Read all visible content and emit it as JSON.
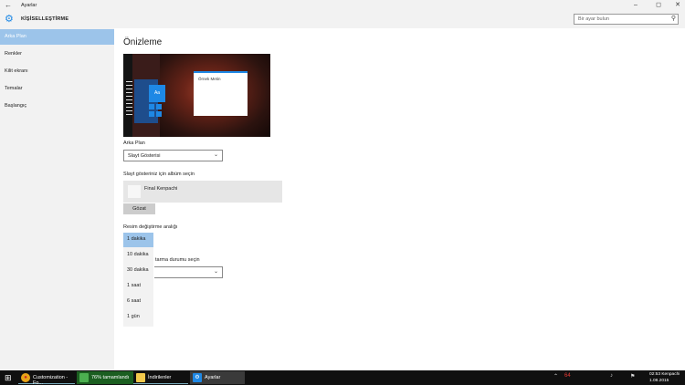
{
  "titlebar": {
    "back": "←",
    "title": "Ayarlar",
    "minimize": "–",
    "maximize": "◻",
    "close": "✕"
  },
  "header": {
    "gear": "⚙",
    "title": "KİŞİSELLEŞTİRME"
  },
  "search": {
    "placeholder": "Bir ayar bulun",
    "icon": "⚲"
  },
  "sidebar": {
    "items": [
      {
        "label": "Arka Plan"
      },
      {
        "label": "Renkler"
      },
      {
        "label": "Kilit ekranı"
      },
      {
        "label": "Temalar"
      },
      {
        "label": "Başlangıç"
      }
    ]
  },
  "main": {
    "title": "Önizleme",
    "preview_sample_text": "Örnek Metin",
    "preview_tile_text": "Aa",
    "background_label": "Arka Plan",
    "background_value": "Slayt Gösterisi",
    "album_label": "Slayt gösteriniz için albüm seçin",
    "album_name": "Final Kenpachi",
    "browse_label": "Gözat",
    "interval_label": "Resim değiştirme aralığı",
    "interval_options": [
      "1 dakika",
      "10 dakika",
      "30 dakika",
      "1 saat",
      "6 saat",
      "1 gün"
    ],
    "fit_label": "tarma durumu seçin",
    "chevron": "⌄"
  },
  "taskbar": {
    "start": "⊞",
    "tasks": [
      {
        "label": "Customization - Fo...",
        "icon": "●"
      },
      {
        "label": "76% tamamlandı",
        "icon": ""
      },
      {
        "label": "İndirilenler",
        "icon": ""
      },
      {
        "label": "Ayarlar",
        "icon": "⚙"
      }
    ],
    "tray": [
      "⌃",
      "64",
      "♪",
      "⚑"
    ],
    "time": "02:53 Kenpachi",
    "date": "1.08.2015"
  }
}
